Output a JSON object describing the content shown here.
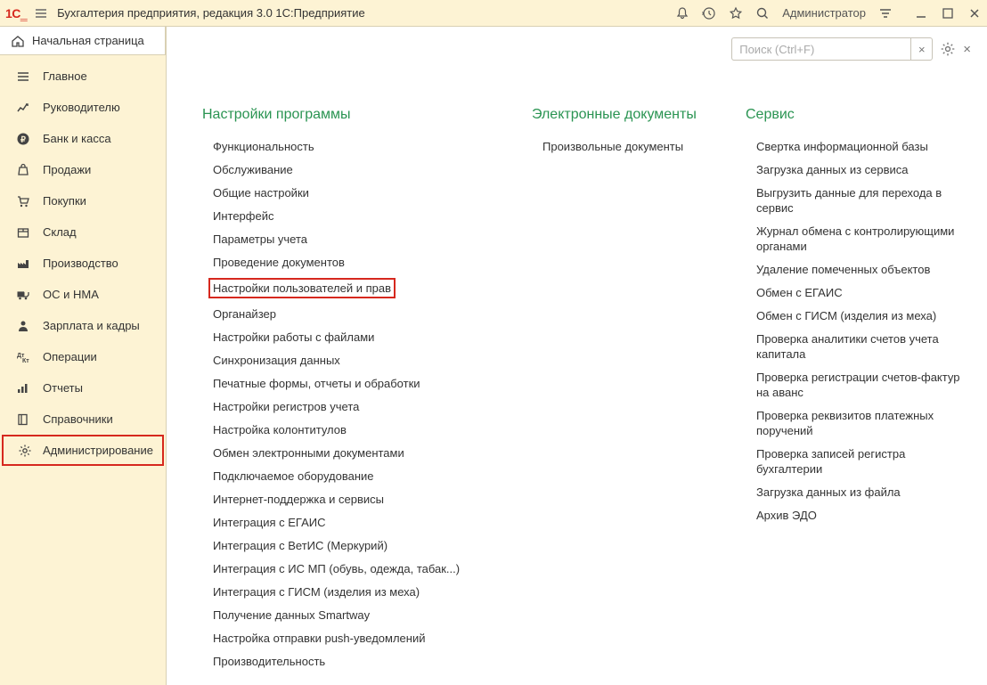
{
  "titlebar": {
    "title": "Бухгалтерия предприятия, редакция 3.0 1С:Предприятие",
    "user": "Администратор"
  },
  "home_tab": "Начальная страница",
  "sidebar": {
    "items": [
      {
        "label": "Главное",
        "icon": "menu"
      },
      {
        "label": "Руководителю",
        "icon": "chart"
      },
      {
        "label": "Банк и касса",
        "icon": "ruble"
      },
      {
        "label": "Продажи",
        "icon": "bag"
      },
      {
        "label": "Покупки",
        "icon": "cart"
      },
      {
        "label": "Склад",
        "icon": "box"
      },
      {
        "label": "Производство",
        "icon": "factory"
      },
      {
        "label": "ОС и НМА",
        "icon": "truck"
      },
      {
        "label": "Зарплата и кадры",
        "icon": "person"
      },
      {
        "label": "Операции",
        "icon": "ledger"
      },
      {
        "label": "Отчеты",
        "icon": "bars"
      },
      {
        "label": "Справочники",
        "icon": "book"
      },
      {
        "label": "Администрирование",
        "icon": "gear",
        "selected": true
      }
    ]
  },
  "search": {
    "placeholder": "Поиск (Ctrl+F)"
  },
  "sections": {
    "program_settings": {
      "title": "Настройки программы",
      "items": [
        "Функциональность",
        "Обслуживание",
        "Общие настройки",
        "Интерфейс",
        "Параметры учета",
        "Проведение документов",
        "Настройки пользователей и прав",
        "Органайзер",
        "Настройки работы с файлами",
        "Синхронизация данных",
        "Печатные формы, отчеты и обработки",
        "Настройки регистров учета",
        "Настройка колонтитулов",
        "Обмен электронными документами",
        "Подключаемое оборудование",
        "Интернет-поддержка и сервисы",
        "Интеграция с ЕГАИС",
        "Интеграция с ВетИС (Меркурий)",
        "Интеграция с ИС МП (обувь, одежда, табак...)",
        "Интеграция с ГИСМ (изделия из меха)",
        "Получение данных Smartway",
        "Настройка отправки push-уведомлений",
        "Производительность"
      ],
      "highlighted_index": 6
    },
    "edocs": {
      "title": "Электронные документы",
      "items": [
        "Произвольные документы"
      ]
    },
    "service": {
      "title": "Сервис",
      "items": [
        "Свертка информационной базы",
        "Загрузка данных из сервиса",
        "Выгрузить данные для перехода в сервис",
        "Журнал обмена с контролирующими органами",
        "Удаление помеченных объектов",
        "Обмен с ЕГАИС",
        "Обмен с ГИСМ (изделия из меха)",
        "Проверка аналитики счетов учета капитала",
        "Проверка регистрации счетов-фактур на аванс",
        "Проверка реквизитов платежных поручений",
        "Проверка записей регистра бухгалтерии",
        "Загрузка данных из файла",
        "Архив ЭДО"
      ]
    }
  }
}
